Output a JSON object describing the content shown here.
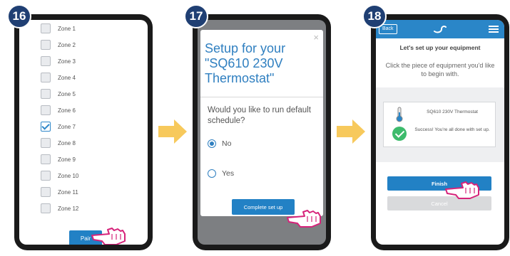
{
  "steps": [
    "16",
    "17",
    "18"
  ],
  "panel16": {
    "zones": [
      {
        "label": "Zone 1",
        "checked": false
      },
      {
        "label": "Zone 2",
        "checked": false
      },
      {
        "label": "Zone 3",
        "checked": false
      },
      {
        "label": "Zone 4",
        "checked": false
      },
      {
        "label": "Zone 5",
        "checked": false
      },
      {
        "label": "Zone 6",
        "checked": false
      },
      {
        "label": "Zone 7",
        "checked": true
      },
      {
        "label": "Zone 8",
        "checked": false
      },
      {
        "label": "Zone 9",
        "checked": false
      },
      {
        "label": "Zone 10",
        "checked": false
      },
      {
        "label": "Zone 11",
        "checked": false
      },
      {
        "label": "Zone 12",
        "checked": false
      }
    ],
    "pair_label": "Pair"
  },
  "panel17": {
    "close_glyph": "×",
    "title": "Setup for your \"SQ610 230V Thermostat\"",
    "question": "Would you like to run default schedule?",
    "option_no": "No",
    "option_yes": "Yes",
    "selected": "No",
    "complete_label": "Complete set up"
  },
  "panel18": {
    "back_label": "Back",
    "heading": "Let's set up your equipment",
    "instruction": "Click the piece of equipment you'd like to begin with.",
    "device_name": "SQ610 230V Thermostat",
    "success_text": "Success! You're all done with set up.",
    "finish_label": "Finish",
    "cancel_label": "Cancel"
  },
  "colors": {
    "accent_blue": "#2281c5",
    "header_blue": "#2a86c8",
    "badge_navy": "#1f3f73",
    "arrow_yellow": "#f7c95c",
    "success_green": "#3dbb6c"
  }
}
